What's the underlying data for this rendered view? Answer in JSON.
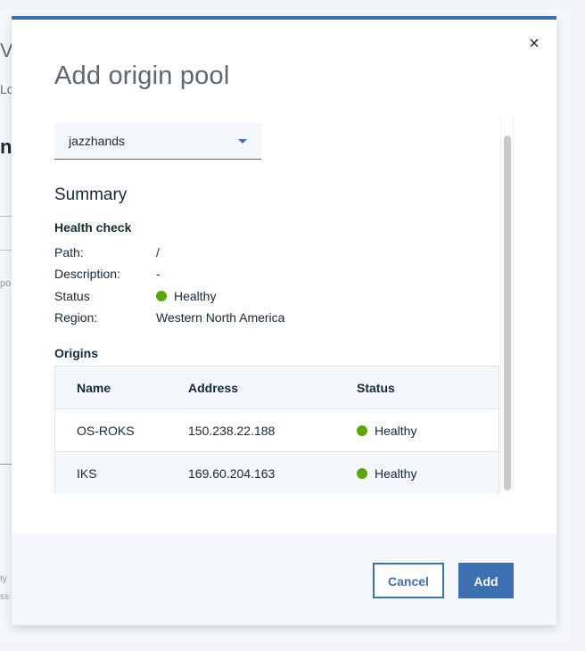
{
  "background": {
    "fragments": [
      "V",
      "Lo",
      "nc",
      "po",
      "ty",
      "ss c"
    ]
  },
  "modal": {
    "title": "Add origin pool",
    "close_glyph": "×",
    "select": {
      "value": "jazzhands"
    },
    "summary": {
      "heading": "Summary",
      "health_check": {
        "heading": "Health check",
        "path_label": "Path:",
        "path_value": "/",
        "description_label": "Description:",
        "description_value": "-",
        "status_label": "Status",
        "status_value": "Healthy",
        "region_label": "Region:",
        "region_value": "Western North America"
      },
      "origins": {
        "heading": "Origins",
        "columns": [
          "Name",
          "Address",
          "Status"
        ],
        "rows": [
          {
            "name": "OS-ROKS",
            "address": "150.238.22.188",
            "status": "Healthy"
          },
          {
            "name": "IKS",
            "address": "169.60.204.163",
            "status": "Healthy"
          }
        ]
      }
    },
    "footer": {
      "cancel_label": "Cancel",
      "add_label": "Add"
    }
  },
  "colors": {
    "accent": "#3d70b2",
    "healthy": "#5aa700",
    "footer_bg": "#f4f7fb"
  },
  "icons": {
    "close": "close-icon",
    "caret": "chevron-down-icon",
    "status": "status-dot-icon"
  }
}
